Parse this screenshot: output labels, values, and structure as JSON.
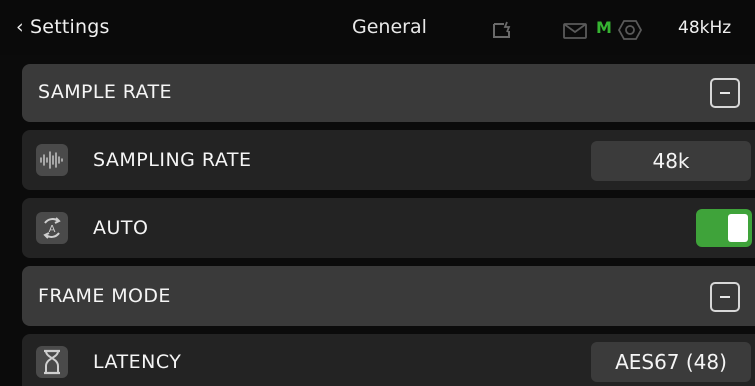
{
  "header": {
    "back_label": "‹ Settings",
    "title": "General",
    "status_m": "M",
    "sample_rate": "48kHz",
    "icons": [
      "sd-card-icon",
      "mail-icon",
      "camera-icon"
    ],
    "accent": "#36b532"
  },
  "sections": [
    {
      "label": "SAMPLE RATE",
      "collapse": "minus"
    },
    {
      "label": "FRAME MODE",
      "collapse": "minus"
    }
  ],
  "rows": {
    "sampling_rate": {
      "label": "SAMPLING RATE",
      "value": "48k",
      "icon": "waveform-icon"
    },
    "auto": {
      "label": "AUTO",
      "icon": "auto-sync-icon",
      "toggle_on": true,
      "toggle_color": "#3fa33a"
    },
    "latency": {
      "label": "LATENCY",
      "value": "AES67 (48)",
      "icon": "hourglass-icon"
    }
  }
}
